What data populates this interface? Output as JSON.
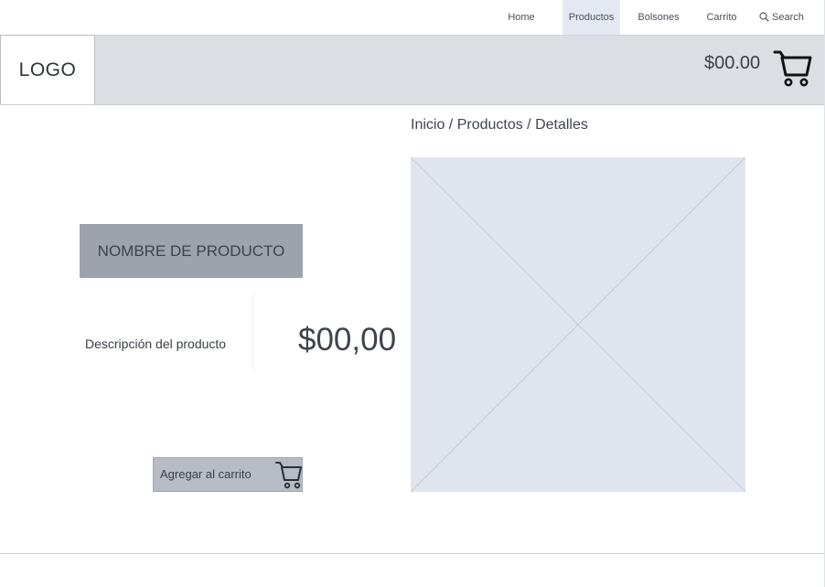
{
  "nav": {
    "home": "Home",
    "productos": "Productos",
    "bolsones": "Bolsones",
    "carrito": "Carrito",
    "search": "Search",
    "active": "Productos"
  },
  "header": {
    "logo": "LOGO",
    "cart_total": "$00.00"
  },
  "breadcrumb": "Inicio / Productos / Detalles",
  "product": {
    "name": "NOMBRE DE PRODUCTO",
    "description": "Descripción del producto",
    "price": "$00,00",
    "add_to_cart_label": "Agregar al carrito"
  },
  "icons": {
    "search": "search-icon",
    "cart": "cart-icon",
    "image_placeholder": "image-placeholder-icon"
  },
  "colors": {
    "header_bg": "#dcdee3",
    "active_tab_bg": "#e4e8f1",
    "product_name_bg": "#9ca3ad",
    "button_bg": "#b7bbc3",
    "placeholder_bg": "#e0e5ed"
  }
}
